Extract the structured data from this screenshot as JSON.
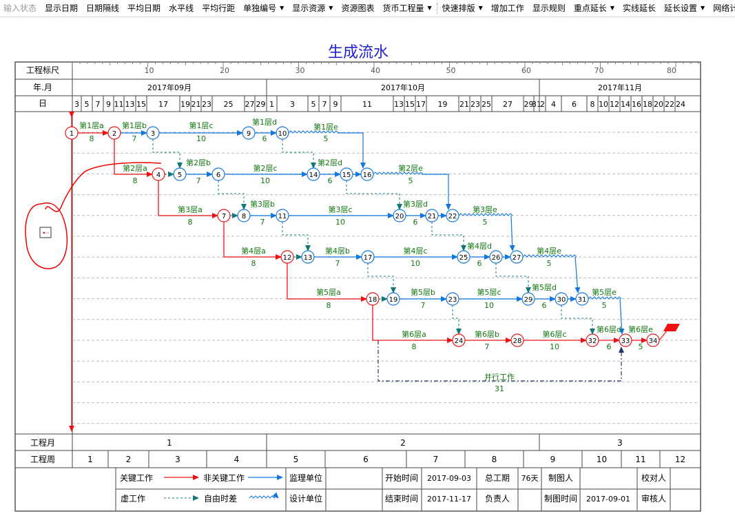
{
  "toolbar": {
    "items": [
      {
        "label": "输入状态",
        "disabled": true
      },
      {
        "label": "显示日期"
      },
      {
        "label": "日期隔线"
      },
      {
        "label": "平均日期"
      },
      {
        "label": "水平线"
      },
      {
        "label": "平均行距"
      },
      {
        "label": "单独编号",
        "dropdown": true
      },
      {
        "label": "显示资源",
        "dropdown": true
      },
      {
        "label": "资源图表"
      },
      {
        "label": "货币工程量",
        "dropdown": true
      },
      {
        "label": "快速排版",
        "dropdown": true,
        "grip": true
      },
      {
        "label": "增加工作"
      },
      {
        "label": "显示规则"
      },
      {
        "label": "重点延长",
        "dropdown": true
      },
      {
        "label": "实线延长"
      },
      {
        "label": "延长设置",
        "dropdown": true
      },
      {
        "label": "网络计划"
      }
    ]
  },
  "title": "生成流水",
  "header": {
    "scale_label": "工程标尺",
    "scale_ticks": [
      "10",
      "20",
      "30",
      "40",
      "50",
      "60",
      "70",
      "80"
    ],
    "yearmonth_label": "年.月",
    "months": [
      "2017年09月",
      "2017年10月",
      "2017年11月"
    ],
    "day_label": "日",
    "days": [
      "3",
      "5",
      "7",
      "9",
      "11",
      "13",
      "15",
      "17",
      "19",
      "21",
      "23",
      "25",
      "27",
      "29",
      "1",
      "3",
      "5",
      "7",
      "9",
      "11",
      "13",
      "15",
      "17",
      "19",
      "21",
      "23",
      "25",
      "27",
      "29",
      "31",
      "2",
      "4",
      "6",
      "8",
      "10",
      "12",
      "14",
      "16",
      "18",
      "20",
      "22",
      "24"
    ]
  },
  "footer": {
    "month_label": "工程月",
    "month_values": [
      "1",
      "2",
      "3"
    ],
    "week_label": "工程周",
    "week_values": [
      "1",
      "2",
      "3",
      "4",
      "5",
      "6",
      "7",
      "8",
      "9",
      "10",
      "11",
      "12"
    ]
  },
  "nodes": [
    {
      "id": "1",
      "critical": true
    },
    {
      "id": "2",
      "critical": true
    },
    {
      "id": "3"
    },
    {
      "id": "9"
    },
    {
      "id": "10"
    },
    {
      "id": "4",
      "critical": true
    },
    {
      "id": "5"
    },
    {
      "id": "6"
    },
    {
      "id": "14"
    },
    {
      "id": "15"
    },
    {
      "id": "16"
    },
    {
      "id": "7",
      "critical": true
    },
    {
      "id": "8"
    },
    {
      "id": "11"
    },
    {
      "id": "20"
    },
    {
      "id": "21"
    },
    {
      "id": "22"
    },
    {
      "id": "12",
      "critical": true
    },
    {
      "id": "13"
    },
    {
      "id": "17"
    },
    {
      "id": "25"
    },
    {
      "id": "26"
    },
    {
      "id": "27"
    },
    {
      "id": "18",
      "critical": true
    },
    {
      "id": "19"
    },
    {
      "id": "23"
    },
    {
      "id": "29"
    },
    {
      "id": "30"
    },
    {
      "id": "31"
    },
    {
      "id": "24",
      "critical": true
    },
    {
      "id": "28",
      "critical": true
    },
    {
      "id": "32",
      "critical": true
    },
    {
      "id": "33",
      "critical": true
    },
    {
      "id": "34",
      "critical": true
    }
  ],
  "activities": [
    {
      "name": "第1层a",
      "duration": "8"
    },
    {
      "name": "第1层b",
      "duration": "7"
    },
    {
      "name": "第1层c",
      "duration": "10"
    },
    {
      "name": "第1层d",
      "duration": "6"
    },
    {
      "name": "第1层e",
      "duration": "5"
    },
    {
      "name": "第2层a",
      "duration": "8"
    },
    {
      "name": "第2层b",
      "duration": "7"
    },
    {
      "name": "第2层c",
      "duration": "10"
    },
    {
      "name": "第2层d",
      "duration": "6"
    },
    {
      "name": "第2层e",
      "duration": "5"
    },
    {
      "name": "第3层a",
      "duration": "8"
    },
    {
      "name": "第3层b",
      "duration": "7"
    },
    {
      "name": "第3层c",
      "duration": "10"
    },
    {
      "name": "第3层d",
      "duration": "6"
    },
    {
      "name": "第3层e",
      "duration": "5"
    },
    {
      "name": "第4层a",
      "duration": "8"
    },
    {
      "name": "第4层b",
      "duration": "7"
    },
    {
      "name": "第4层c",
      "duration": "10"
    },
    {
      "name": "第4层d",
      "duration": "6"
    },
    {
      "name": "第4层e",
      "duration": "5"
    },
    {
      "name": "第5层a",
      "duration": "8"
    },
    {
      "name": "第5层b",
      "duration": "7"
    },
    {
      "name": "第5层c",
      "duration": "10"
    },
    {
      "name": "第5层d",
      "duration": "6"
    },
    {
      "name": "第5层e",
      "duration": "5"
    },
    {
      "name": "第6层a",
      "duration": "8"
    },
    {
      "name": "第6层b",
      "duration": "7"
    },
    {
      "name": "第6层c",
      "duration": "10"
    },
    {
      "name": "第6层d",
      "duration": "6"
    },
    {
      "name": "第6层e",
      "duration": "5"
    },
    {
      "name": "并行工作",
      "duration": "31"
    }
  ],
  "legend": {
    "critical": "关键工作",
    "noncritical": "非关键工作",
    "dummy": "虚工作",
    "float": "自由时差",
    "supervisor_label": "监理单位",
    "design_label": "设计单位",
    "start_label": "开始时间",
    "start_value": "2017-09-03",
    "end_label": "结束时间",
    "end_value": "2017-11-17",
    "duration_label": "总工期",
    "duration_value": "76天",
    "owner_label": "负责人",
    "drawer_label": "制图人",
    "drawtime_label": "制图时间",
    "drawtime_value": "2017-09-01",
    "checker_label": "校对人",
    "reviewer_label": "审核人"
  },
  "colors": {
    "critical": "#ee1111",
    "noncritical": "#1177dd",
    "dummy": "#117777",
    "label": "#117711",
    "title": "#2222cc",
    "annotation": "#ee0000"
  }
}
